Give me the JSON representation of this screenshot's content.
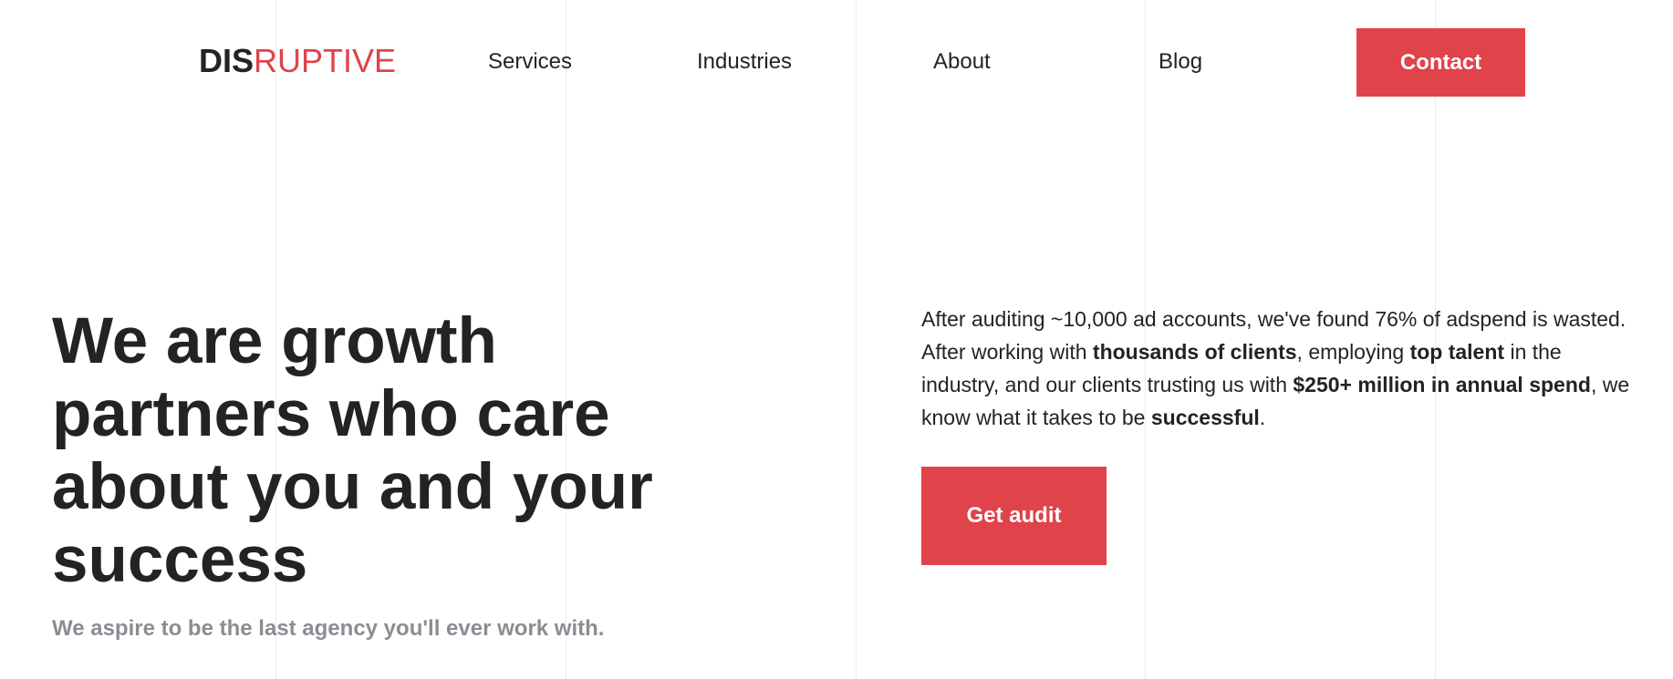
{
  "header": {
    "logo": {
      "part1": "DIS",
      "part2": "RUPTIVE"
    },
    "nav": [
      {
        "label": "Services"
      },
      {
        "label": "Industries"
      },
      {
        "label": "About"
      },
      {
        "label": "Blog"
      }
    ],
    "contact_label": "Contact"
  },
  "hero": {
    "headline_lines": [
      "We are growth",
      "partners who care",
      "about you and your",
      "success"
    ],
    "subtitle": "We aspire to be the last agency you'll ever work with.",
    "intro": {
      "t1": "After auditing ~10,000 ad accounts, we've found 76% of adspend is wasted. After working with ",
      "b1": "thousands of clients",
      "t2": ", employing ",
      "b2": "top talent",
      "t3": " in the industry, and our clients trusting us with ",
      "b3": "$250+ million in annual spend",
      "t4": ", we know what it takes to be ",
      "b4": "successful",
      "t5": "."
    },
    "cta_label": "Get audit"
  },
  "colors": {
    "accent": "#e0434a",
    "text": "#232323",
    "muted": "#8a8d92",
    "grid_line": "#ececec"
  }
}
